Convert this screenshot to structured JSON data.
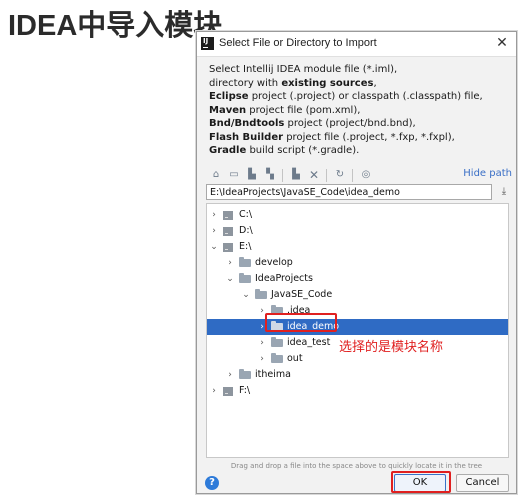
{
  "slide_title": "IDEA中导入模块",
  "dialog": {
    "title": "Select File or Directory to Import",
    "close": "✕",
    "description_lines": [
      {
        "pre": "Select Intellij IDEA module file (*.iml),",
        "bold": "",
        "post": ""
      },
      {
        "pre": "directory with ",
        "bold": "existing sources",
        "post": ","
      },
      {
        "pre": "",
        "bold": "Eclipse",
        "post": " project (.project) or classpath (.classpath) file,"
      },
      {
        "pre": "",
        "bold": "Maven",
        "post": " project file (pom.xml),"
      },
      {
        "pre": "",
        "bold": "Bnd/Bndtools",
        "post": " project (project/bnd.bnd),"
      },
      {
        "pre": "",
        "bold": "Flash Builder",
        "post": " project file (.project, *.fxp, *.fxpl),"
      },
      {
        "pre": "",
        "bold": "Gradle",
        "post": " build script (*.gradle)."
      }
    ],
    "toolbar": {
      "icons": [
        "home-icon",
        "desktop-icon",
        "project-folder-icon",
        "module-folder-icon",
        "new-folder-icon",
        "delete-icon",
        "refresh-icon",
        "show-hidden-icon"
      ],
      "hide_path": "Hide path"
    },
    "path_value": "E:\\IdeaProjects\\JavaSE_Code\\idea_demo",
    "tree": [
      {
        "label": "C:\\",
        "depth": 0,
        "expanded": false,
        "kind": "drive"
      },
      {
        "label": "D:\\",
        "depth": 0,
        "expanded": false,
        "kind": "drive"
      },
      {
        "label": "E:\\",
        "depth": 0,
        "expanded": true,
        "kind": "drive"
      },
      {
        "label": "develop",
        "depth": 1,
        "expanded": false,
        "kind": "folder"
      },
      {
        "label": "IdeaProjects",
        "depth": 1,
        "expanded": true,
        "kind": "folder"
      },
      {
        "label": "JavaSE_Code",
        "depth": 2,
        "expanded": true,
        "kind": "folder"
      },
      {
        "label": ".idea",
        "depth": 3,
        "expanded": false,
        "kind": "folder"
      },
      {
        "label": "idea_demo",
        "depth": 3,
        "expanded": false,
        "kind": "folder",
        "selected": true
      },
      {
        "label": "idea_test",
        "depth": 3,
        "expanded": false,
        "kind": "folder"
      },
      {
        "label": "out",
        "depth": 3,
        "expanded": false,
        "kind": "folder"
      },
      {
        "label": "itheima",
        "depth": 1,
        "expanded": false,
        "kind": "folder"
      },
      {
        "label": "F:\\",
        "depth": 0,
        "expanded": false,
        "kind": "drive"
      }
    ],
    "drag_hint": "Drag and drop a file into the space above to quickly locate it in the tree",
    "help": "?",
    "ok_label": "OK",
    "cancel_label": "Cancel"
  },
  "annotation": "选择的是模块名称",
  "colors": {
    "selection": "#2f6bc4",
    "highlight": "#e02020",
    "link": "#3a6fc6"
  }
}
